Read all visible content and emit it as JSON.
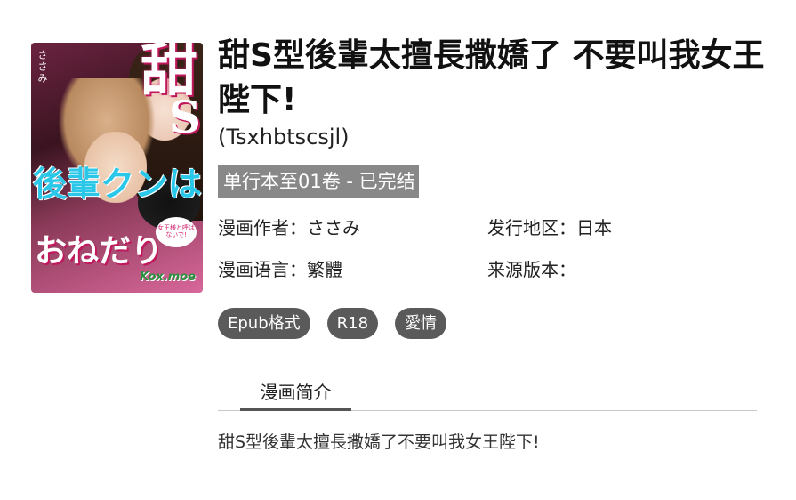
{
  "cover": {
    "title_glyph": "甜",
    "title_letter": "S",
    "author_vertical": "ささみ",
    "subtitle_line1": "後輩クンは",
    "subtitle_line2": "おねだり",
    "bubble_text": "女王様と呼ばないで!",
    "watermark": "Kox.moe"
  },
  "title": "甜S型後輩太擅長撒嬌了 不要叫我女王陛下!",
  "alt_title": "(Tsxhbtscsjl)",
  "status": "单行本至01卷 - 已完结",
  "meta": {
    "author_label": "漫画作者：",
    "author_value": "ささみ",
    "region_label": "发行地区：",
    "region_value": "日本",
    "language_label": "漫画语言：",
    "language_value": "繁體",
    "source_label": "来源版本：",
    "source_value": ""
  },
  "tags": [
    "Epub格式",
    "R18",
    "愛情"
  ],
  "tabs": {
    "summary_tab": "漫画简介"
  },
  "summary": "甜S型後輩太擅長撒嬌了不要叫我女王陛下!"
}
